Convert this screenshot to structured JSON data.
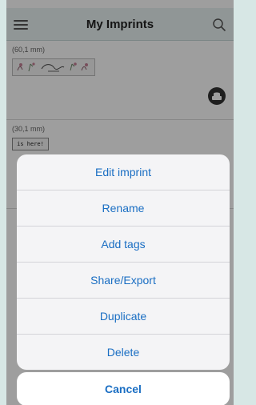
{
  "header": {
    "title": "My Imprints",
    "menu_icon": "hamburger-icon",
    "search_icon": "search-icon"
  },
  "imprints": [
    {
      "size_label": "(60,1 mm)",
      "preview_text": ""
    },
    {
      "size_label": "(30,1 mm)",
      "preview_text": "is here!"
    }
  ],
  "action_sheet": {
    "items": [
      "Edit imprint",
      "Rename",
      "Add tags",
      "Share/Export",
      "Duplicate",
      "Delete"
    ],
    "cancel_label": "Cancel"
  },
  "colors": {
    "accent": "#1a6ec3",
    "header_bg": "#e9f3f3",
    "outer_bg": "#d7e7e5"
  }
}
